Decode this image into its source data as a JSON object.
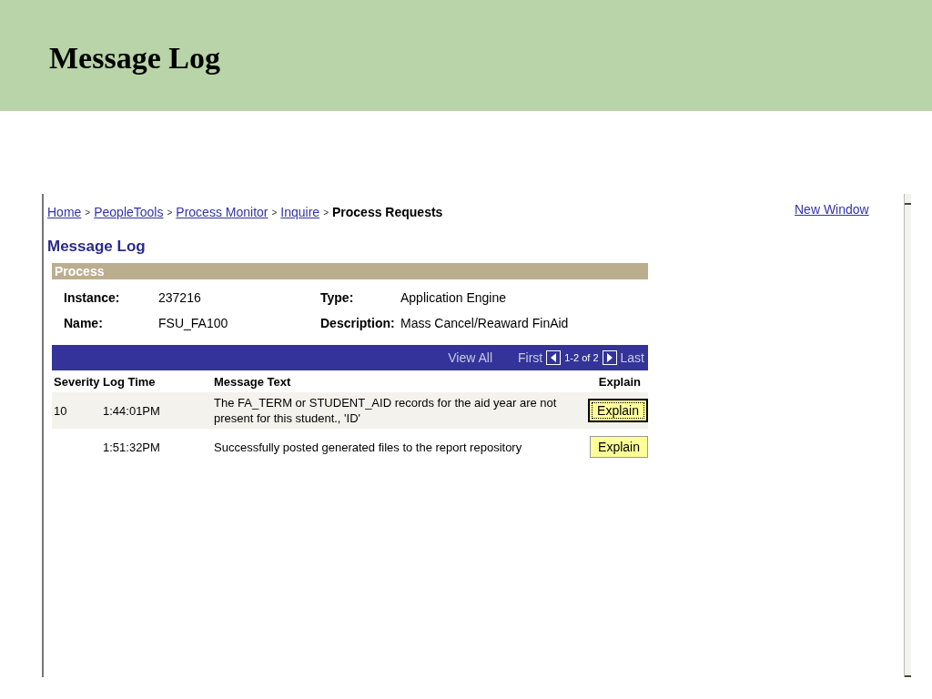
{
  "slide": {
    "title": "Message Log"
  },
  "breadcrumb": {
    "links": [
      "Home",
      "PeopleTools",
      "Process Monitor",
      "Inquire"
    ],
    "separator": ">",
    "current": "Process Requests"
  },
  "new_window": "New Window",
  "page_title": "Message Log",
  "process": {
    "header": "Process",
    "fields": [
      {
        "label": "Instance:",
        "value": "237216"
      },
      {
        "label": "Type:",
        "value": "Application Engine"
      },
      {
        "label": "Name:",
        "value": "FSU_FA100"
      },
      {
        "label": "Description:",
        "value": "Mass Cancel/Reaward FinAid"
      }
    ]
  },
  "grid": {
    "view_all": "View All",
    "first": "First",
    "range": "1-2 of 2",
    "last": "Last",
    "columns": [
      "Severity",
      "Log Time",
      "Message Text",
      "Explain"
    ],
    "rows": [
      {
        "severity": "10",
        "log_time": "1:44:01PM",
        "message": "The FA_TERM or STUDENT_AID records for the aid year are not present for this student., 'ID'",
        "button": "Explain",
        "focused": true
      },
      {
        "log_time": "1:51:32PM",
        "message": "Successfully posted generated files to the report repository",
        "button": "Explain",
        "focused": false
      }
    ]
  }
}
